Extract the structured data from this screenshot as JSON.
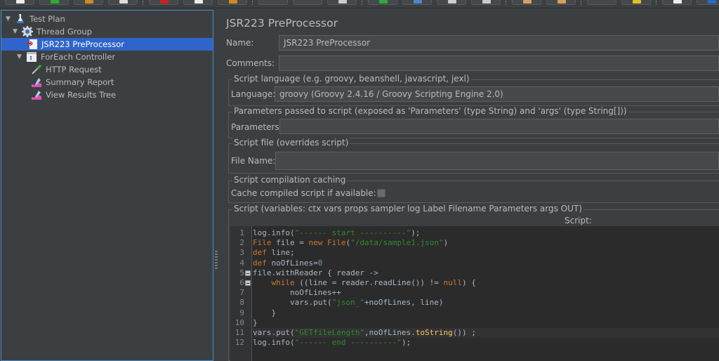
{
  "toolbar": {
    "buttons": [
      {
        "icon": "new-icon",
        "color": "#eeeeee"
      },
      {
        "icon": "templates-icon",
        "color": "#2eaa3a"
      },
      {
        "icon": "open-icon",
        "color": "#d08a20"
      },
      {
        "icon": "save-icon",
        "color": "#dddddd"
      },
      {
        "icon": "cut-icon",
        "color": "#cc2222"
      },
      {
        "icon": "copy-icon",
        "color": "#eeeeee"
      },
      {
        "icon": "paste-icon",
        "color": "#d08a20"
      },
      {
        "icon": "expand-icon",
        "color": "#45494a"
      },
      {
        "icon": "collapse-icon",
        "color": "#45494a"
      },
      {
        "icon": "toggle-icon",
        "color": "#cccccc"
      },
      {
        "icon": "start-icon",
        "color": "#2eaa3a"
      },
      {
        "icon": "start-no-pauses-icon",
        "color": "#4a88c7"
      },
      {
        "icon": "stop-icon",
        "color": "#cccccc"
      },
      {
        "icon": "shutdown-icon",
        "color": "#cccccc"
      },
      {
        "icon": "remote-start-icon",
        "color": "#d8a060"
      },
      {
        "icon": "remote-stop-icon",
        "color": "#d8a060"
      },
      {
        "icon": "clear-icon",
        "color": "#45494a"
      },
      {
        "icon": "clear-all-icon",
        "color": "#e0c020"
      },
      {
        "icon": "search-icon",
        "color": "#eeeeee"
      },
      {
        "icon": "reset-search-icon",
        "color": "#2a6acd"
      }
    ]
  },
  "tree": {
    "items": [
      {
        "label": "Test Plan",
        "icon": "test-plan-flask-icon",
        "level": 0,
        "expanded": true,
        "selected": false
      },
      {
        "label": "Thread Group",
        "icon": "thread-group-gear-icon",
        "level": 1,
        "expanded": true,
        "selected": false
      },
      {
        "label": "JSR223 PreProcessor",
        "icon": "preprocessor-icon",
        "level": 2,
        "expanded": null,
        "selected": true
      },
      {
        "label": "ForEach Controller",
        "icon": "foreach-controller-icon",
        "level": 1,
        "expanded": true,
        "selected": false
      },
      {
        "label": "HTTP Request",
        "icon": "http-request-pipette-icon",
        "level": 2,
        "expanded": null,
        "selected": false
      },
      {
        "label": "Summary Report",
        "icon": "listener-chart-icon",
        "level": 2,
        "expanded": null,
        "selected": false
      },
      {
        "label": "View Results Tree",
        "icon": "listener-chart-icon",
        "level": 2,
        "expanded": null,
        "selected": false
      }
    ]
  },
  "panel": {
    "title": "JSR223 PreProcessor",
    "name_label": "Name:",
    "name_value": "JSR223 PreProcessor",
    "comments_label": "Comments:",
    "comments_value": "",
    "language_group": "Script language (e.g. groovy, beanshell, javascript, jexl)",
    "language_label": "Language:",
    "language_value": "groovy     (Groovy 2.4.16 / Groovy Scripting Engine 2.0)",
    "params_group": "Parameters passed to script (exposed as 'Parameters' (type String) and 'args' (type String[]))",
    "params_label": "Parameters:",
    "params_value": "",
    "file_group": "Script file (overrides script)",
    "file_label": "File Name:",
    "file_value": "",
    "cache_group": "Script compilation caching",
    "cache_label": "Cache compiled script if available:",
    "cache_checked": false,
    "script_group": "Script (variables: ctx vars props sampler log Label Filename Parameters args OUT)",
    "script_label": "Script:"
  },
  "editor": {
    "current_line": 11,
    "lines": [
      {
        "n": "1",
        "fold": false,
        "tokens": [
          [
            "plain",
            "log.info("
          ],
          [
            "str",
            "\"------ start ----------\""
          ],
          [
            "plain",
            ");"
          ]
        ]
      },
      {
        "n": "2",
        "fold": false,
        "tokens": [
          [
            "kw",
            "File"
          ],
          [
            "plain",
            " file = "
          ],
          [
            "kw",
            "new"
          ],
          [
            "plain",
            " "
          ],
          [
            "kw",
            "File"
          ],
          [
            "plain",
            "("
          ],
          [
            "str",
            "\"/data/sample1.json\""
          ],
          [
            "plain",
            ")"
          ]
        ]
      },
      {
        "n": "3",
        "fold": false,
        "tokens": [
          [
            "kw",
            "def"
          ],
          [
            "plain",
            " line;"
          ]
        ]
      },
      {
        "n": "4",
        "fold": false,
        "tokens": [
          [
            "kw",
            "def"
          ],
          [
            "plain",
            " noOfLines="
          ],
          [
            "num",
            "0"
          ]
        ]
      },
      {
        "n": "5",
        "fold": true,
        "tokens": [
          [
            "plain",
            "file.withReader { reader ->"
          ]
        ]
      },
      {
        "n": "6",
        "fold": true,
        "tokens": [
          [
            "plain",
            "    "
          ],
          [
            "kw",
            "while"
          ],
          [
            "plain",
            " ((line = reader.readLine()) != "
          ],
          [
            "kw",
            "null"
          ],
          [
            "plain",
            ") {"
          ]
        ]
      },
      {
        "n": "7",
        "fold": false,
        "tokens": [
          [
            "plain",
            "        noOfLines++"
          ]
        ]
      },
      {
        "n": "8",
        "fold": false,
        "tokens": [
          [
            "plain",
            "        vars.put("
          ],
          [
            "str",
            "\"json_\""
          ],
          [
            "plain",
            "+noOfLines, line)"
          ]
        ]
      },
      {
        "n": "9",
        "fold": false,
        "tokens": [
          [
            "plain",
            "    }"
          ]
        ]
      },
      {
        "n": "10",
        "fold": false,
        "tokens": [
          [
            "plain",
            "}"
          ]
        ]
      },
      {
        "n": "11",
        "fold": false,
        "tokens": [
          [
            "plain",
            "vars.put("
          ],
          [
            "str",
            "\"GETfileLength\""
          ],
          [
            "plain",
            ",noOfLines."
          ],
          [
            "fn",
            "toString"
          ],
          [
            "plain",
            "()) ;"
          ]
        ]
      },
      {
        "n": "12",
        "fold": false,
        "tokens": [
          [
            "plain",
            "log.info("
          ],
          [
            "str",
            "\"------ end ----------\""
          ],
          [
            "plain",
            ");"
          ]
        ]
      }
    ]
  }
}
